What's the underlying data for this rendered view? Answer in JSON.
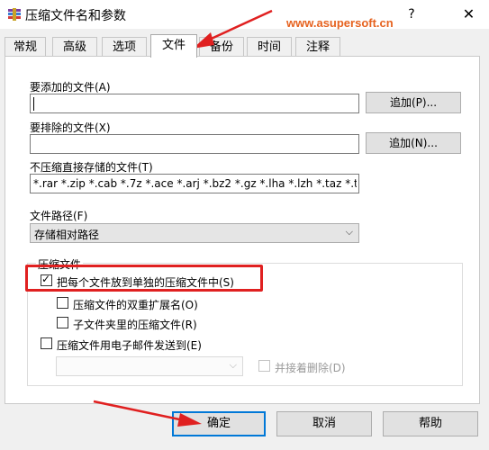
{
  "window": {
    "title": "压缩文件名和参数",
    "help_glyph": "?",
    "close_glyph": "✕"
  },
  "watermark": "www.asupersoft.cn",
  "tabs": [
    {
      "label": "常规",
      "active": false
    },
    {
      "label": "高级",
      "active": false
    },
    {
      "label": "选项",
      "active": false
    },
    {
      "label": "文件",
      "active": true
    },
    {
      "label": "备份",
      "active": false
    },
    {
      "label": "时间",
      "active": false
    },
    {
      "label": "注释",
      "active": false
    }
  ],
  "files": {
    "add_label": "要添加的文件(A)",
    "add_value": "",
    "add_button": "追加(P)...",
    "exclude_label": "要排除的文件(X)",
    "exclude_value": "",
    "exclude_button": "追加(N)...",
    "store_label": "不压缩直接存储的文件(T)",
    "store_value": "*.rar *.zip *.cab *.7z *.ace *.arj *.bz2 *.gz *.lha *.lzh *.taz *.tgz"
  },
  "path": {
    "label": "文件路径(F)",
    "selected": "存储相对路径"
  },
  "archives": {
    "title": "压缩文件",
    "separate": {
      "label": "把每个文件放到单独的压缩文件中(S)",
      "checked": true
    },
    "double_ext": {
      "label": "压缩文件的双重扩展名(O)",
      "checked": false
    },
    "subfolder": {
      "label": "子文件夹里的压缩文件(R)",
      "checked": false
    },
    "email": {
      "label": "压缩文件用电子邮件发送到(E)",
      "checked": false
    },
    "email_to": "",
    "delete_after": {
      "label": "并接着删除(D)",
      "checked": false
    }
  },
  "footer": {
    "ok": "确定",
    "cancel": "取消",
    "help": "帮助"
  },
  "colors": {
    "annotation": "#e02020",
    "default_button_border": "#0078d7",
    "watermark": "#e6621f"
  }
}
